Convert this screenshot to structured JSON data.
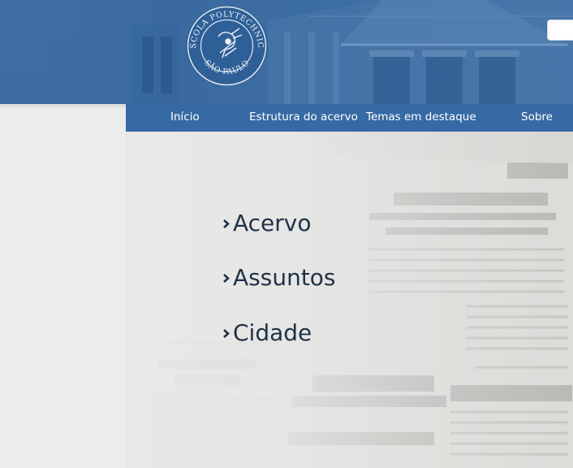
{
  "logo": {
    "ring_text": "ESCOLA POLYTECHNICA",
    "bottom_text": "SÃO PAULO"
  },
  "search": {
    "value": ""
  },
  "nav": {
    "items": [
      {
        "label": "Início"
      },
      {
        "label": "Estrutura do acervo"
      },
      {
        "label": "Temas em destaque"
      },
      {
        "label": "Sobre"
      }
    ]
  },
  "main": {
    "links": [
      {
        "label": "Acervo"
      },
      {
        "label": "Assuntos"
      },
      {
        "label": "Cidade"
      }
    ]
  },
  "colors": {
    "header_blue": "#3d6ea2",
    "nav_blue": "#376aa4",
    "link_text": "#1f3246",
    "sidebar_gray": "#ececec"
  }
}
